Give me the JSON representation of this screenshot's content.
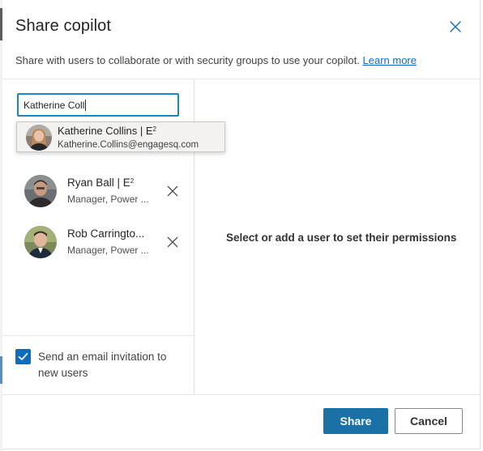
{
  "dialog": {
    "title": "Share copilot",
    "subtitle": "Share with users to collaborate or with security groups to use your copilot.",
    "learn_more": "Learn more"
  },
  "search": {
    "value": "Katherine Coll"
  },
  "suggestion": {
    "name": "Katherine Collins | E",
    "sup": "2",
    "email": "Katherine.Collins@engagesq.com"
  },
  "users": [
    {
      "name": "Ryan Ball | E",
      "sup": "2",
      "role": "Manager, Power ...",
      "avatar": "avatar-ryan"
    },
    {
      "name": "Rob Carringto...",
      "sup": "",
      "role": "Manager, Power ...",
      "avatar": "avatar-rob"
    }
  ],
  "invite": {
    "checked": true,
    "label": "Send an email invitation to new users"
  },
  "right_pane": {
    "message": "Select or add a user to set their permissions"
  },
  "footer": {
    "share_label": "Share",
    "cancel_label": "Cancel"
  },
  "colors": {
    "accent": "#0f6cbd",
    "primary_button": "#1971a6",
    "focus_border": "#1a86c9"
  }
}
